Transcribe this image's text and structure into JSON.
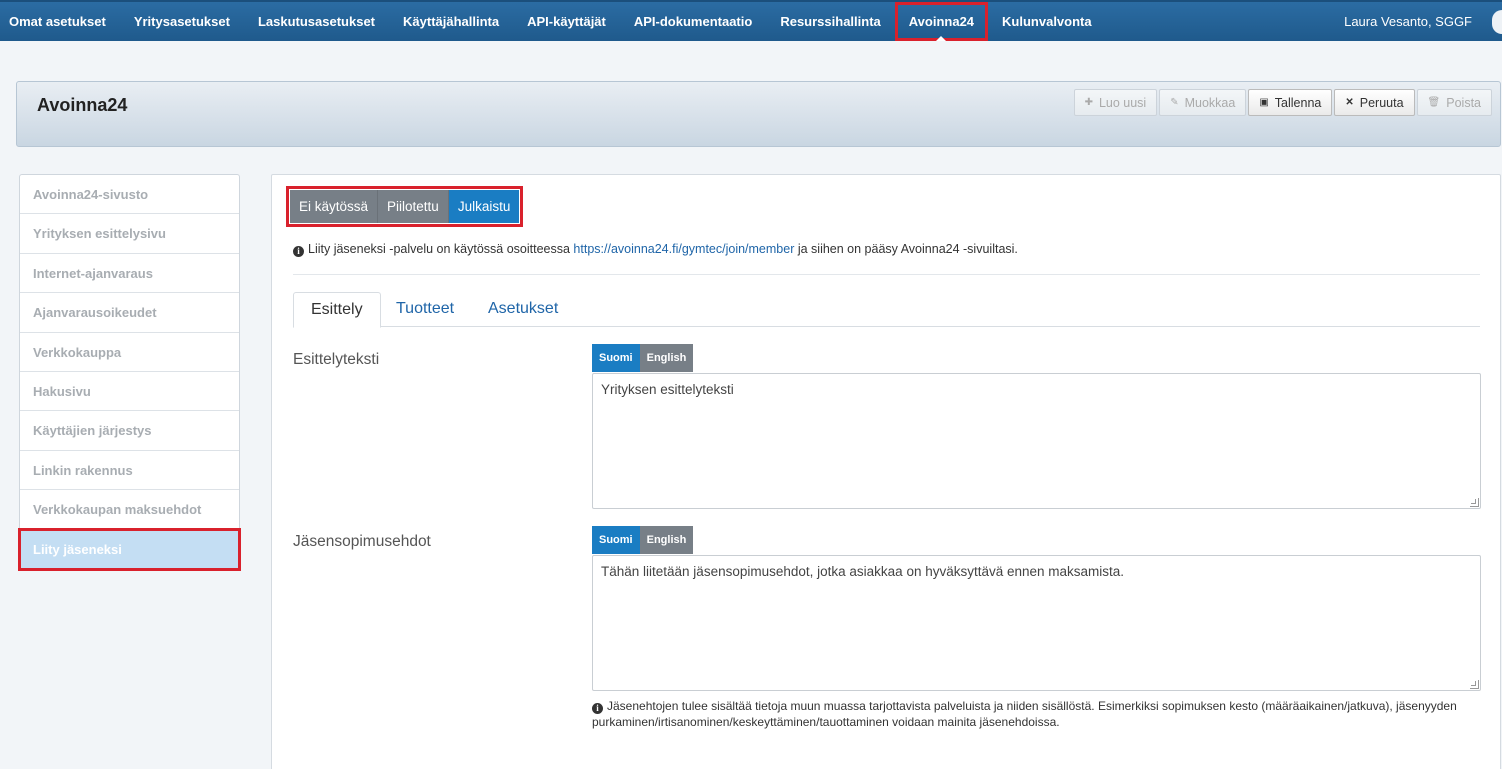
{
  "topnav": {
    "items": [
      {
        "label": "Omat asetukset"
      },
      {
        "label": "Yritysasetukset"
      },
      {
        "label": "Laskutusasetukset"
      },
      {
        "label": "Käyttäjähallinta"
      },
      {
        "label": "API-käyttäjät"
      },
      {
        "label": "API-dokumentaatio"
      },
      {
        "label": "Resurssihallinta"
      },
      {
        "label": "Avoinna24",
        "active": true
      },
      {
        "label": "Kulunvalvonta"
      }
    ],
    "user": "Laura Vesanto, SGGF"
  },
  "page": {
    "title": "Avoinna24",
    "actions": {
      "new": "Luo uusi",
      "edit": "Muokkaa",
      "save": "Tallenna",
      "cancel": "Peruuta",
      "delete": "Poista"
    }
  },
  "sidebar": {
    "items": [
      {
        "label": "Avoinna24-sivusto"
      },
      {
        "label": "Yrityksen esittelysivu"
      },
      {
        "label": "Internet-ajanvaraus"
      },
      {
        "label": "Ajanvarausoikeudet"
      },
      {
        "label": "Verkkokauppa"
      },
      {
        "label": "Hakusivu"
      },
      {
        "label": "Käyttäjien järjestys"
      },
      {
        "label": "Linkin rakennus"
      },
      {
        "label": "Verkkokaupan maksuehdot"
      },
      {
        "label": "Liity jäseneksi",
        "active": true
      }
    ]
  },
  "status": {
    "options": [
      "Ei käytössä",
      "Piilotettu",
      "Julkaistu"
    ],
    "selected": "Julkaistu"
  },
  "info": {
    "before": "Liity jäseneksi -palvelu on käytössä osoitteessa ",
    "link": "https://avoinna24.fi/gymtec/join/member",
    "after": " ja siihen on pääsy Avoinna24 -sivuiltasi."
  },
  "tabs": {
    "items": [
      "Esittely",
      "Tuotteet",
      "Asetukset"
    ],
    "active": "Esittely"
  },
  "fields": {
    "intro": {
      "label": "Esittelyteksti",
      "lang": [
        "Suomi",
        "English"
      ],
      "value": "Yrityksen esittelyteksti"
    },
    "terms": {
      "label": "Jäsensopimusehdot",
      "lang": [
        "Suomi",
        "English"
      ],
      "value": "Tähän liitetään jäsensopimusehdot, jotka asiakkaa on hyväksyttävä ennen maksamista.",
      "help": "Jäsenehtojen tulee sisältää tietoja muun muassa tarjottavista palveluista ja niiden sisällöstä. Esimerkiksi sopimuksen kesto (määräaikainen/jatkuva), jäsenyyden purkaminen/irtisanominen/keskeyttäminen/tauottaminen voidaan mainita jäsenehdoissa."
    }
  },
  "colors": {
    "nav": "#1f5a8c",
    "accent": "#1a7dc3",
    "highlight": "#d9212c"
  }
}
